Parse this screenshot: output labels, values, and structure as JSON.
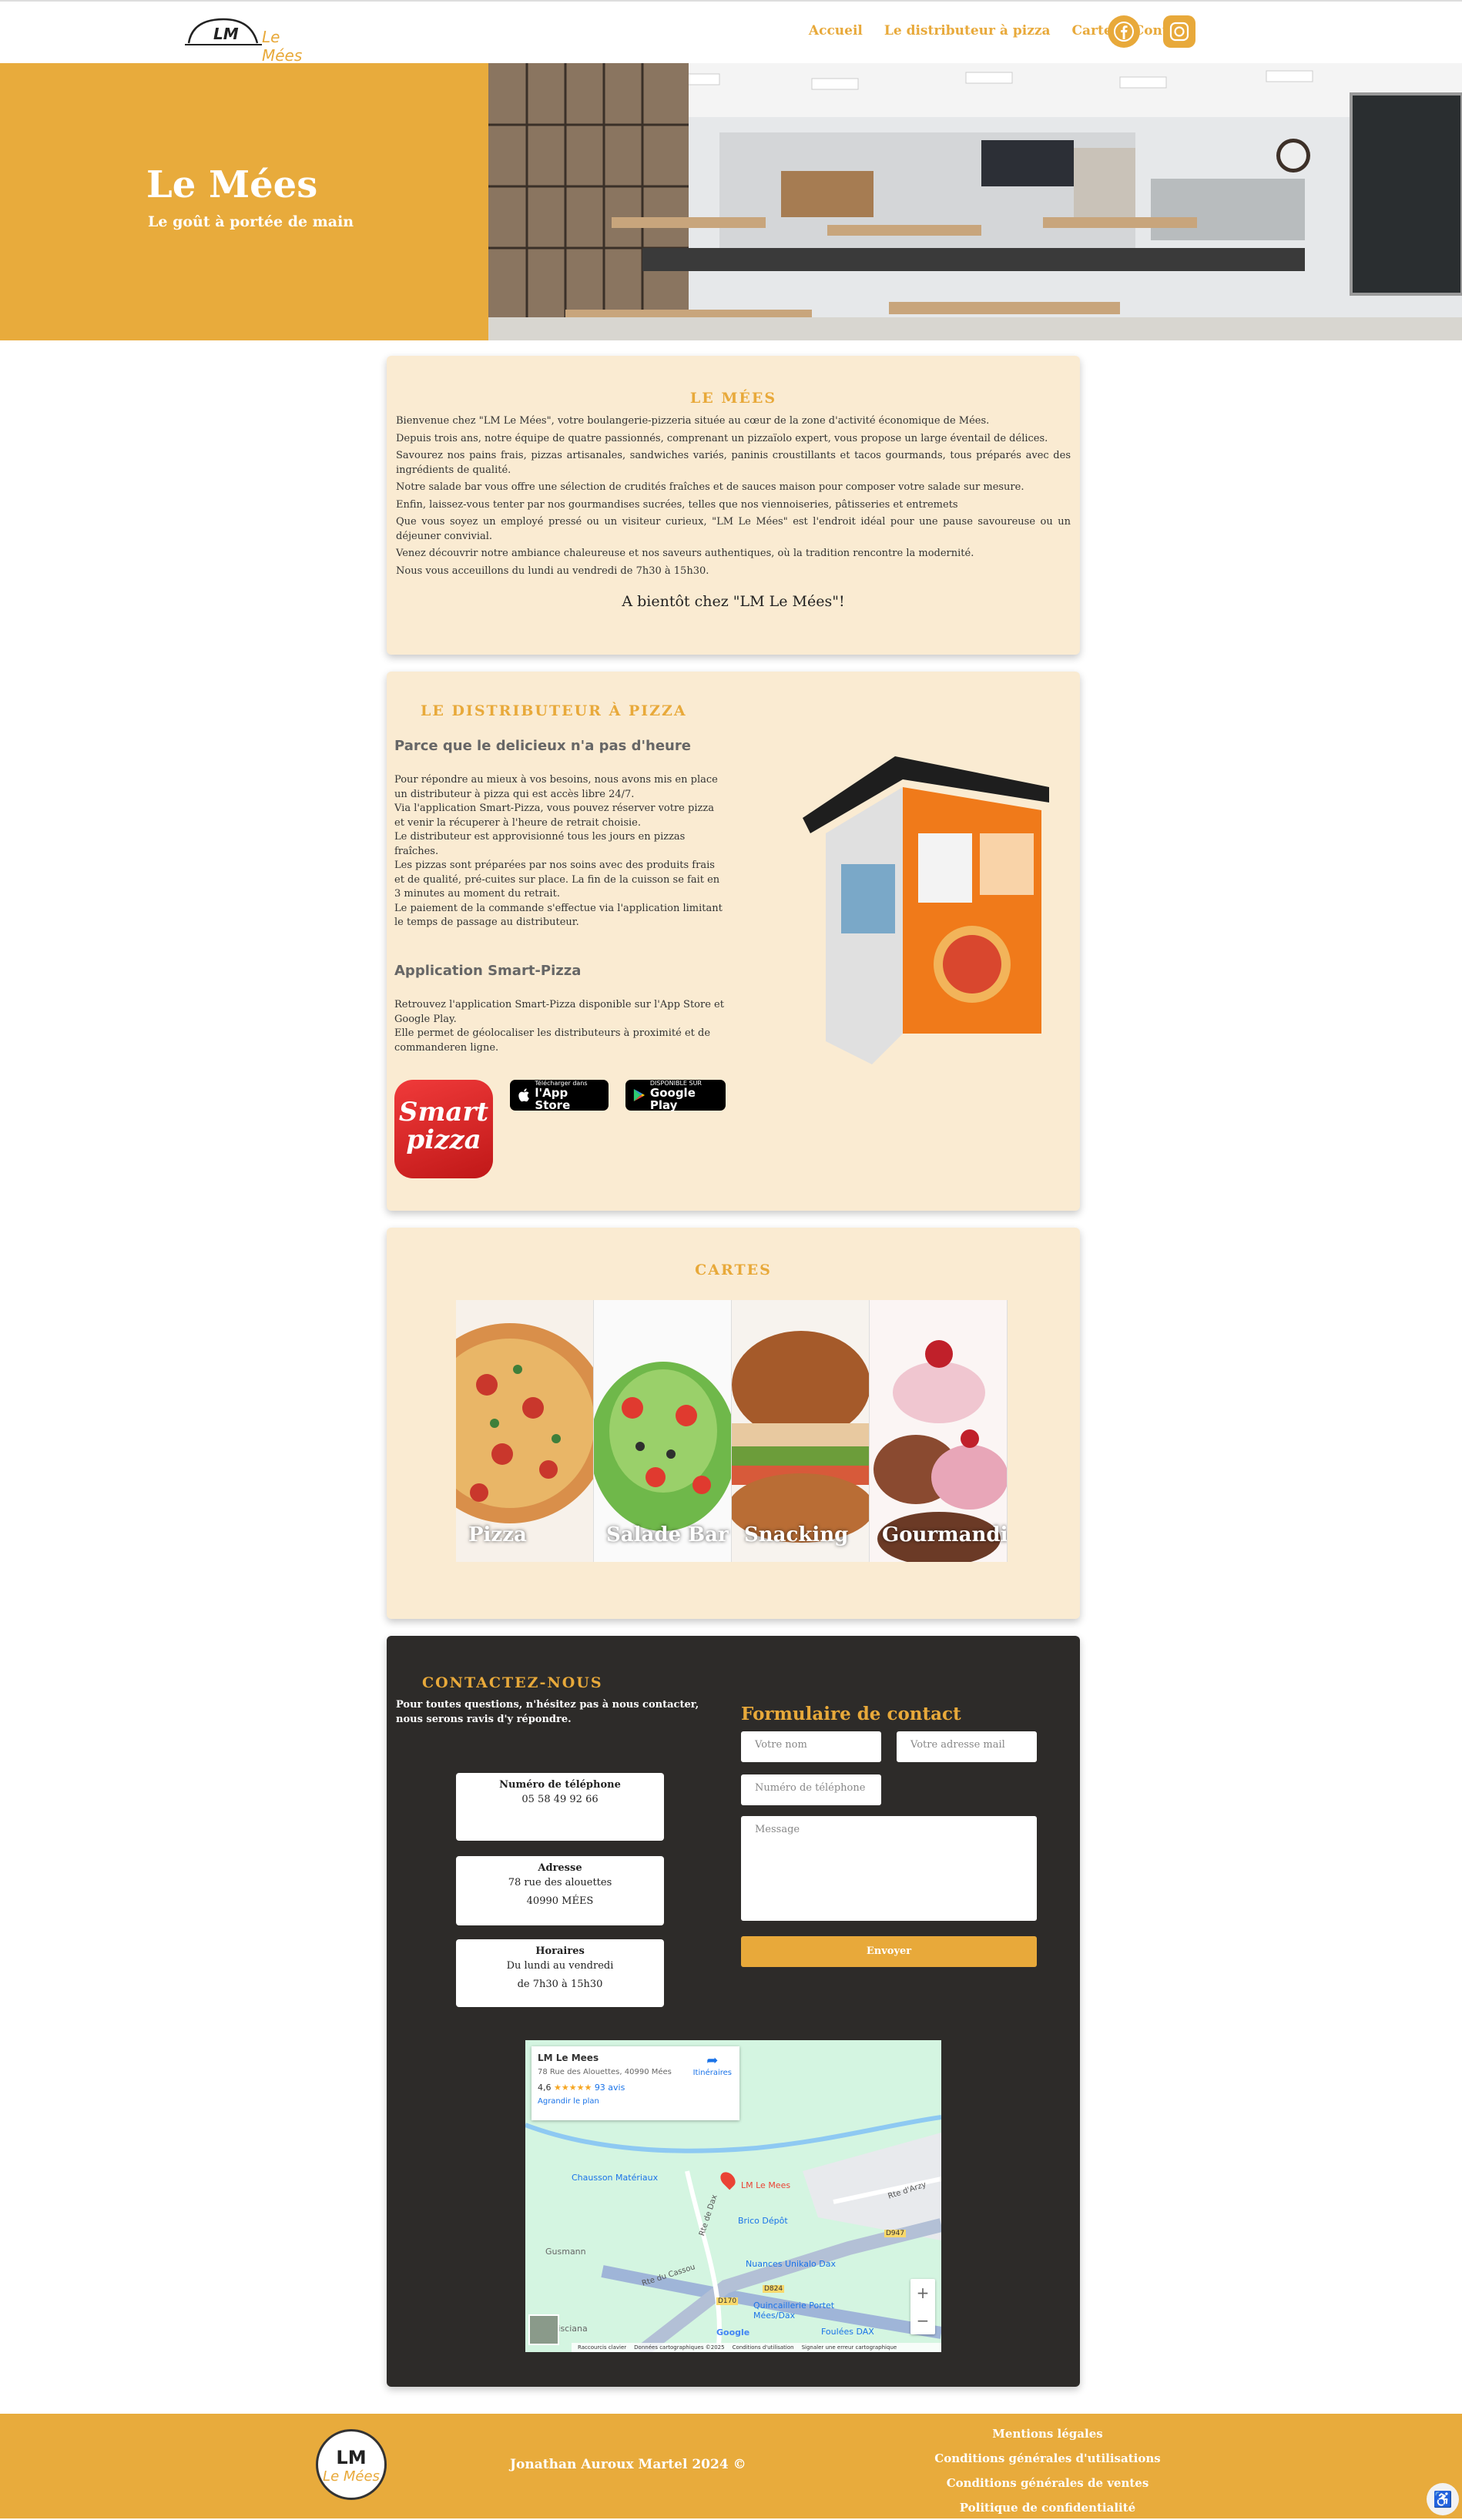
{
  "brand": {
    "logo_initials": "LM",
    "logo_name": "Le Mées"
  },
  "nav": {
    "items": [
      "Accueil",
      "Le distributeur à pizza",
      "Carte",
      "Contact"
    ],
    "social": [
      "facebook-icon",
      "instagram-icon"
    ]
  },
  "hero": {
    "title": "Le Mées",
    "subtitle": "Le goût à portée de main"
  },
  "about": {
    "title": "Le Mées",
    "paragraphs": [
      "Bienvenue chez \"LM Le Mées\", votre boulangerie-pizzeria située au cœur de la zone d'activité économique de Mées.",
      "Depuis trois ans, notre équipe de quatre passionnés, comprenant un pizzaïolo expert, vous propose un large éventail de délices.",
      "Savourez nos pains frais, pizzas artisanales, sandwiches variés, paninis croustillants et tacos gourmands, tous préparés avec des ingrédients de qualité.",
      "Notre salade bar vous offre une sélection de crudités fraîches et de sauces maison pour composer votre salade sur mesure.",
      "Enfin, laissez-vous tenter par nos gourmandises sucrées, telles que nos viennoiseries, pâtisseries et entremets",
      "Que vous soyez un employé pressé ou un visiteur curieux, \"LM Le Mées\" est l'endroit idéal pour une pause savoureuse ou un déjeuner convivial.",
      "Venez découvrir notre ambiance chaleureuse et nos saveurs authentiques, où la tradition rencontre la modernité.",
      "Nous vous acceuillons du lundi au vendredi de 7h30 à 15h30."
    ],
    "closing": "A bientôt chez \"LM Le Mées\"!"
  },
  "distributor": {
    "title": "Le distributeur à pizza",
    "subtitle": "Parce que le delicieux n'a pas d'heure",
    "paragraphs": [
      "Pour répondre au mieux à vos besoins, nous avons mis en place un distributeur à pizza qui est accès libre 24/7.",
      "Via l'application Smart-Pizza, vous pouvez réserver votre pizza et venir la récuperer à l'heure de retrait choisie.",
      "Le distributeur est approvisionné tous les jours en pizzas fraîches.",
      "Les pizzas sont préparées par nos soins avec des produits frais et de qualité, pré-cuites sur place. La fin de la cuisson se fait en 3 minutes au moment du retrait.",
      "Le paiement de la commande s'effectue via l'application limitant le temps de passage au distributeur."
    ],
    "app_title": "Application Smart-Pizza",
    "app_paragraphs": [
      "Retrouvez l'application Smart-Pizza disponible sur l'App Store et Google Play.",
      "Elle permet de géolocaliser les distributeurs à proximité et de commanderen ligne."
    ],
    "app_icon_line1": "Smart",
    "app_icon_line2": "pizza",
    "appstore": {
      "small": "Télécharger dans",
      "big": "l'App Store"
    },
    "googleplay": {
      "small": "DISPONIBLE SUR",
      "big": "Google Play"
    }
  },
  "cartes": {
    "title": "Cartes",
    "items": [
      "Pizza",
      "Salade Bar",
      "Snacking",
      "Gourmandise"
    ]
  },
  "contact": {
    "title": "Contactez-nous",
    "intro": "Pour toutes questions, n'hésitez pas à nous contacter, nous serons ravis d'y répondre.",
    "phone_label": "Numéro de téléphone",
    "phone": "05 58 49 92 66",
    "address_label": "Adresse",
    "address_line1": "78 rue des alouettes",
    "address_line2": "40990 MÉES",
    "hours_label": "Horaires",
    "hours_line1": "Du lundi au vendredi",
    "hours_line2": "de 7h30 à 15h30",
    "form_title": "Formulaire de contact",
    "name_placeholder": "Votre nom",
    "email_placeholder": "Votre adresse mail",
    "phone_placeholder": "Numéro de téléphone",
    "message_placeholder": "Message",
    "submit": "Envoyer"
  },
  "map": {
    "place": "LM Le Mees",
    "address": "78 Rue des Alouettes, 40990 Mées",
    "rating": "4,6",
    "reviews": "93 avis",
    "enlarge": "Agrandir le plan",
    "directions": "Itinéraires",
    "pins": [
      "Chausson Matériaux",
      "LM Le Mees",
      "Brico Dépôt",
      "Nuances Unikalo Dax",
      "Quincaillerie Portet Mées/Dax",
      "Foulées DAX",
      "Gusmann",
      "Pisciana"
    ],
    "roads": [
      "Rte d'Arzy",
      "Rte de Dax",
      "Rte du Cassou",
      "D824",
      "D170",
      "D947"
    ],
    "footer": [
      "Raccourcis clavier",
      "Données cartographiques ©2025",
      "Conditions d'utilisation",
      "Signaler une erreur cartographique"
    ],
    "google": "Google"
  },
  "footer": {
    "logo_initials": "LM",
    "logo_name": "Le Mées",
    "copyright": "Jonathan Auroux Martel 2024 ©",
    "links": [
      "Mentions légales",
      "Conditions générales d'utilisations",
      "Conditions générales de ventes",
      "Politique de confidentialité"
    ]
  },
  "colors": {
    "accent": "#e8ab3c",
    "card": "#faebd2",
    "dark": "#2d2b29"
  }
}
